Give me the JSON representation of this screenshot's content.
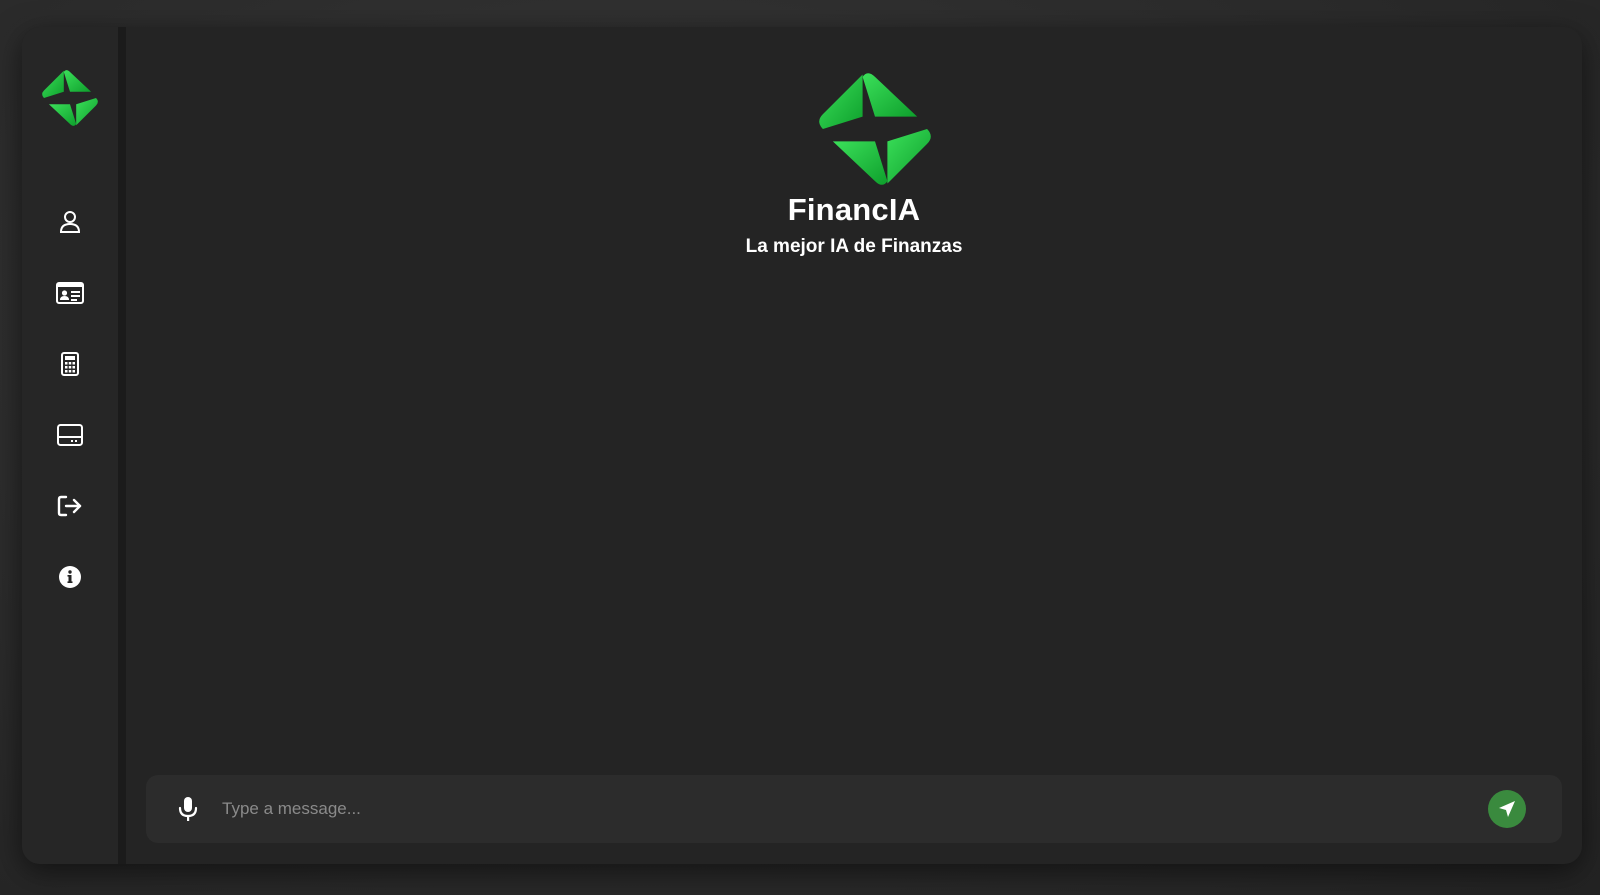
{
  "brand": {
    "name": "FinancIA",
    "tagline": "La mejor IA de Finanzas",
    "logo_colors": [
      "#19c23c",
      "#0aa82a",
      "#3be05a"
    ]
  },
  "sidebar": {
    "items": [
      {
        "icon": "user-icon"
      },
      {
        "icon": "id-card-icon"
      },
      {
        "icon": "calculator-icon"
      },
      {
        "icon": "credit-card-icon"
      },
      {
        "icon": "logout-icon"
      },
      {
        "icon": "info-icon"
      }
    ]
  },
  "composer": {
    "placeholder": "Type a message...",
    "value": "",
    "mic_icon": "microphone-icon",
    "send_icon": "send-icon",
    "send_color": "#3a8a3e"
  },
  "colors": {
    "background": "#242424",
    "sidebar": "#262626",
    "accent": "#19c23c",
    "text": "#ffffff"
  }
}
